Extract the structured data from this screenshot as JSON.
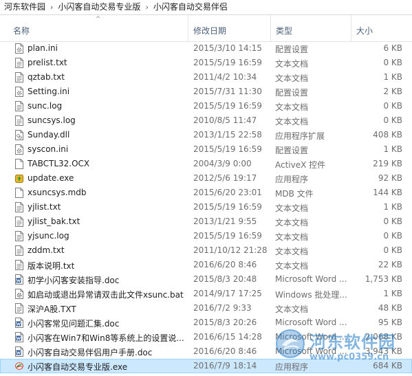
{
  "breadcrumb": {
    "items": [
      "河东软件园",
      "小闪客自动交易专业版",
      "小闪客自动交易伴侣"
    ],
    "separator": "›"
  },
  "columns": {
    "name": "名称",
    "date": "修改日期",
    "type": "类型",
    "size": "大小",
    "sort_indicator": "^"
  },
  "files": [
    {
      "name": "plan.ini",
      "date": "2015/3/10 14:15",
      "type": "配置设置",
      "size": "6 KB",
      "icon": "settings-file-icon"
    },
    {
      "name": "prelist.txt",
      "date": "2015/5/19 16:59",
      "type": "文本文档",
      "size": "0 KB",
      "icon": "text-file-icon"
    },
    {
      "name": "qztab.txt",
      "date": "2011/4/2 10:34",
      "type": "文本文档",
      "size": "1 KB",
      "icon": "text-file-icon"
    },
    {
      "name": "Setting.ini",
      "date": "2015/7/31 11:30",
      "type": "配置设置",
      "size": "2 KB",
      "icon": "settings-file-icon"
    },
    {
      "name": "sunc.log",
      "date": "2015/5/19 16:59",
      "type": "文本文档",
      "size": "0 KB",
      "icon": "text-file-icon"
    },
    {
      "name": "suncsys.log",
      "date": "2010/8/5 11:47",
      "type": "文本文档",
      "size": "0 KB",
      "icon": "text-file-icon"
    },
    {
      "name": "Sunday.dll",
      "date": "2013/1/15 22:58",
      "type": "应用程序扩展",
      "size": "408 KB",
      "icon": "dll-file-icon"
    },
    {
      "name": "syscon.ini",
      "date": "2015/5/19 16:59",
      "type": "配置设置",
      "size": "1 KB",
      "icon": "settings-file-icon"
    },
    {
      "name": "TABCTL32.OCX",
      "date": "2004/3/9 0:00",
      "type": "ActiveX 控件",
      "size": "219 KB",
      "icon": "generic-file-icon"
    },
    {
      "name": "update.exe",
      "date": "2012/5/6 19:17",
      "type": "应用程序",
      "size": "92 KB",
      "icon": "update-exe-icon"
    },
    {
      "name": "xsuncsys.mdb",
      "date": "2015/6/20 23:01",
      "type": "MDB 文件",
      "size": "144 KB",
      "icon": "generic-file-icon"
    },
    {
      "name": "yjlist.txt",
      "date": "2015/5/19 16:59",
      "type": "文本文档",
      "size": "1 KB",
      "icon": "text-file-icon"
    },
    {
      "name": "yjlist_bak.txt",
      "date": "2013/1/21 9:55",
      "type": "文本文档",
      "size": "0 KB",
      "icon": "text-file-icon"
    },
    {
      "name": "yjsunc.log",
      "date": "2015/5/19 16:59",
      "type": "文本文档",
      "size": "0 KB",
      "icon": "text-file-icon"
    },
    {
      "name": "zddm.txt",
      "date": "2011/10/12 21:28",
      "type": "文本文档",
      "size": "0 KB",
      "icon": "text-file-icon"
    },
    {
      "name": "版本说明.txt",
      "date": "2016/6/20 8:46",
      "type": "文本文档",
      "size": "22 KB",
      "icon": "text-file-icon"
    },
    {
      "name": "初学小闪客安装指导.doc",
      "date": "2015/8/3 20:48",
      "type": "Microsoft Word ...",
      "size": "1,753 KB",
      "icon": "word-doc-icon"
    },
    {
      "name": "如启动或退出异常请双击此文件xsunc.bat",
      "date": "2014/9/17 17:25",
      "type": "Windows 批处理...",
      "size": "1 KB",
      "icon": "batch-file-icon"
    },
    {
      "name": "深沪A股.TXT",
      "date": "2016/7/2 9:33",
      "type": "文本文档",
      "size": "48 KB",
      "icon": "text-file-icon"
    },
    {
      "name": "小闪客常见问题汇集.doc",
      "date": "2015/8/3 20:26",
      "type": "Microsoft Word ...",
      "size": "95 KB",
      "icon": "word-doc-icon"
    },
    {
      "name": "小闪客在Win7和Win8等系统上的设置说...",
      "date": "2016/6/15 14:28",
      "type": "Microsoft Word ...",
      "size": "2,068 KB",
      "icon": "word-doc-icon"
    },
    {
      "name": "小闪客自动交易伴侣用户手册.doc",
      "date": "2016/6/20 8:46",
      "type": "Microsoft Word ...",
      "size": "3,943 KB",
      "icon": "word-doc-icon"
    },
    {
      "name": "小闪客自动交易专业版.exe",
      "date": "2016/7/9 18:14",
      "type": "应用程序",
      "size": "684 KB",
      "icon": "app-exe-icon",
      "selected": true
    }
  ],
  "watermark": {
    "title": "河东软件园",
    "url": "www.pc0359.cn",
    "icon": "watermark-logo-icon"
  },
  "colors": {
    "selection_bg": "#cce8ff",
    "selection_border": "#99d1ff",
    "header_text": "#4c607a",
    "meta_text": "#6d6d6d",
    "watermark": "#1e78c8"
  }
}
